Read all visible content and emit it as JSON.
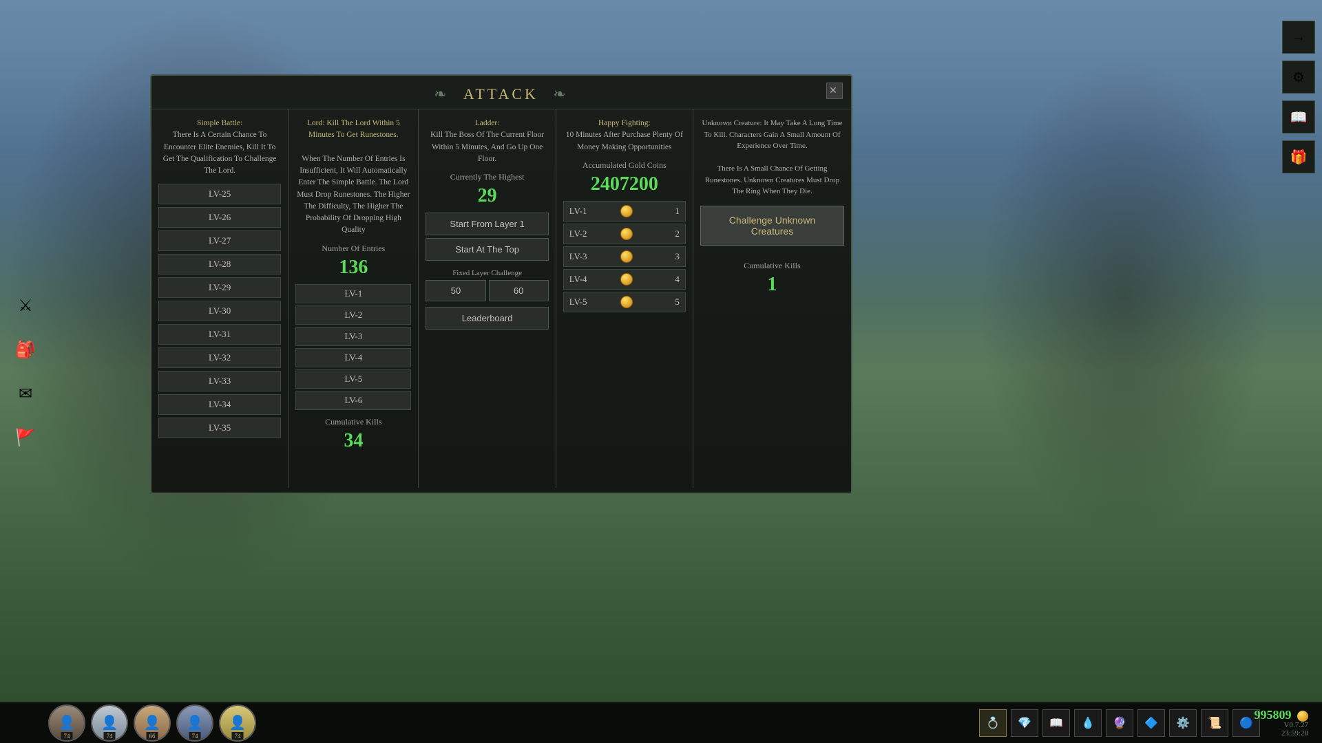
{
  "background": {
    "color": "#2a3a2a"
  },
  "modal": {
    "title": "ATTACK",
    "close_label": "✕",
    "col1": {
      "desc": "Simple Battle:\nThere Is A Certain Chance To Encounter Elite Enemies,\nKill It To Get The Qualification To Challenge The Lord.",
      "levels": [
        "LV-25",
        "LV-26",
        "LV-27",
        "LV-28",
        "LV-29",
        "LV-30",
        "LV-31",
        "LV-32",
        "LV-33",
        "LV-34",
        "LV-35"
      ]
    },
    "col2": {
      "desc1": "Lord: Kill The Lord Within 5 Minutes To Get Runestones.",
      "desc2": "When The Number Of Entries Is Insufficient, It Will Automatically Enter The Simple Battle. The Lord Must Drop Runestones. The Higher The Difficulty, The Higher The Probability Of Dropping High Quality",
      "stat_label": "Number Of Entries",
      "stat_value": "136",
      "levels": [
        "LV-1",
        "LV-2",
        "LV-3",
        "LV-4",
        "LV-5",
        "LV-6"
      ],
      "kills_label": "Cumulative Kills",
      "kills_value": "34"
    },
    "col3": {
      "desc": "Ladder:\nKill The Boss Of The Current Floor Within 5 Minutes, And Go Up One Floor.",
      "stat_label": "Currently The Highest",
      "stat_value": "29",
      "btn1": "Start From Layer 1",
      "btn2": "Start At The Top",
      "fixed_label": "Fixed Layer Challenge",
      "fixed_val1": "50",
      "fixed_val2": "60",
      "leaderboard_btn": "Leaderboard"
    },
    "col4": {
      "desc": "Happy Fighting:\n10 Minutes After Purchase Plenty Of Money Making Opportunities",
      "stat_label": "Accumulated Gold Coins",
      "stat_value": "2407200",
      "rows": [
        {
          "lv": "LV-1",
          "amount": 1
        },
        {
          "lv": "LV-2",
          "amount": 2
        },
        {
          "lv": "LV-3",
          "amount": 3
        },
        {
          "lv": "LV-4",
          "amount": 4
        },
        {
          "lv": "LV-5",
          "amount": 5
        }
      ]
    },
    "col5": {
      "desc": "Unknown Creature: It May Take A Long Time To Kill. Characters Gain A Small Amount Of Experience Over Time.\nThere Is A Small Chance Of Getting Runestones. Unknown Creatures Must Drop The Ring When They Die.",
      "challenge_btn": "Challenge Unknown\nCreatures",
      "kills_label": "Cumulative Kills",
      "kills_value": "1"
    }
  },
  "bottom_bar": {
    "characters": [
      {
        "level": 74,
        "color": "#8a7a6a"
      },
      {
        "level": 74,
        "color": "#7a8a9a"
      },
      {
        "level": 66,
        "color": "#9a8a7a"
      },
      {
        "level": 74,
        "color": "#6a7a8a"
      },
      {
        "level": 74,
        "color": "#c8b878"
      }
    ],
    "items": [
      "💍",
      "💎",
      "📖",
      "💧",
      "🔮",
      "🔷",
      "⚙️",
      "📜",
      "🔵"
    ],
    "gold": "995809",
    "version": "V0.7.27",
    "time": "23:59:28"
  },
  "side_icons_right": [
    "→",
    "⚙",
    "📖",
    "🎁"
  ],
  "side_icons_left": [
    "⚔",
    "🎒",
    "✉",
    "🚩"
  ]
}
